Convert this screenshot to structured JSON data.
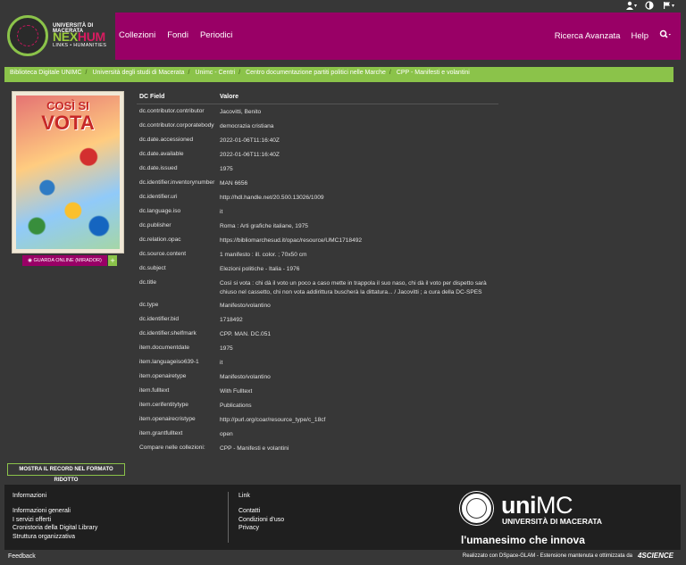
{
  "topbar": {
    "user_icon": "user-icon",
    "contrast_icon": "contrast-icon",
    "language_icon": "flag-icon"
  },
  "header": {
    "logo": {
      "university": "UNIVERSITÀ DI MACERATA",
      "nex": "NEX",
      "hum": "HUM",
      "sub": "LINKS  •  HUMANITIES"
    },
    "nav": [
      "Collezioni",
      "Fondi",
      "Periodici"
    ],
    "advanced_search": "Ricerca Avanzata",
    "help": "Help",
    "search_icon": "search-icon"
  },
  "breadcrumb": [
    "Biblioteca Digitale UNIMC",
    "Università degli studi di Macerata",
    "Unimc - Centri",
    "Centro documentazione partiti politici nelle Marche",
    "CPP - Manifesti e volantini"
  ],
  "thumbnail": {
    "title_line1": "COSÌ SI",
    "title_line2": "VOTA"
  },
  "mirador_button": "GUARDA ONLINE (MIRADOR)",
  "mirador_plus": "+",
  "table": {
    "headers": {
      "field": "DC Field",
      "value": "Valore"
    },
    "rows": [
      {
        "k": "dc.contributor.contributor",
        "v": "Jacovitti, Benito"
      },
      {
        "k": "dc.contributor.corporatebody",
        "v": "democrazia cristiana"
      },
      {
        "k": "dc.date.accessioned",
        "v": "2022-01-06T11:16:40Z"
      },
      {
        "k": "dc.date.available",
        "v": "2022-01-06T11:16:40Z"
      },
      {
        "k": "dc.date.issued",
        "v": "1975"
      },
      {
        "k": "dc.identifier.inventorynumber",
        "v": "MAN 6656"
      },
      {
        "k": "dc.identifier.uri",
        "v": "http://hdl.handle.net/20.500.13026/1009"
      },
      {
        "k": "dc.language.iso",
        "v": "it"
      },
      {
        "k": "dc.publisher",
        "v": "Roma : Arti grafiche italiane, 1975"
      },
      {
        "k": "dc.relation.opac",
        "v": "https://bibliomarchesud.it/opac/resource/UMC1718492"
      },
      {
        "k": "dc.source.content",
        "v": "1 manifesto : ill. color. ; 70x50 cm"
      },
      {
        "k": "dc.subject",
        "v": "Elezioni politiche - Italia - 1976"
      },
      {
        "k": "dc.title",
        "v": "Così si vota : chi dà il voto un poco a caso mette in trappola il suo naso, chi dà il voto per dispetto sarà chiuso nel cassetto, chi non vota addirittura buscherà la dittatura... / Jacovitti ; a cura della DC-SPES"
      },
      {
        "k": "dc.type",
        "v": "Manifesto/volantino"
      },
      {
        "k": "dc.identifier.bid",
        "v": "1718492"
      },
      {
        "k": "dc.identifier.shelfmark",
        "v": "CPP. MAN. DC.051"
      },
      {
        "k": "item.documentdate",
        "v": "1975"
      },
      {
        "k": "item.languageiso639-1",
        "v": "it"
      },
      {
        "k": "item.openairetype",
        "v": "Manifesto/volantino"
      },
      {
        "k": "item.fulltext",
        "v": "With Fulltext"
      },
      {
        "k": "item.cerifentitytype",
        "v": "Publications"
      },
      {
        "k": "item.openairecristype",
        "v": "http://purl.org/coar/resource_type/c_18cf"
      },
      {
        "k": "item.grantfulltext",
        "v": "open"
      },
      {
        "k": "Compare nelle collezioni:",
        "v": "CPP - Manifesti e volantini"
      }
    ]
  },
  "short_record_button": "MOSTRA IL RECORD NEL FORMATO RIDOTTO",
  "footer": {
    "info_heading": "Informazioni",
    "info_links": [
      "Informazioni generali",
      "I servizi offerti",
      "Cronistoria della Digital Library",
      "Struttura organizzativa"
    ],
    "link_heading": "Link",
    "link_links": [
      "Contatti",
      "Condizioni d'uso",
      "Privacy"
    ],
    "unimc_uni": "uni",
    "unimc_mc": "MC",
    "unimc_univ": "UNIVERSITÀ DI MACERATA",
    "motto": "l'umanesimo che innova"
  },
  "bottombar": {
    "feedback": "Feedback",
    "realized": "Realizzato con DSpace-GLAM - Estensione mantenuta e ottimizzata da",
    "brand": "4SCIENCE"
  }
}
